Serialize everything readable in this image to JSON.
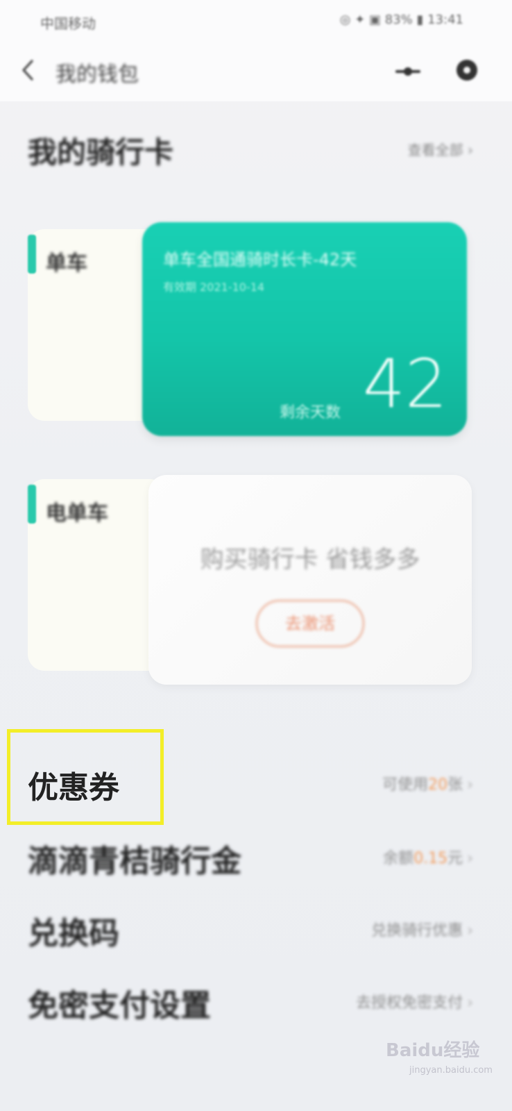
{
  "status_bar": {
    "carrier": "中国移动",
    "right_info": "◎ ✦ ▣ 83% ▮ 13:41"
  },
  "header": {
    "title": "我的钱包",
    "back_icon": "chevron-left-icon",
    "minimize_icon": "minimize-icon",
    "more_icon": "more-circle-icon"
  },
  "cards_section": {
    "title": "我的骑行卡",
    "view_all": "查看全部 ›",
    "categories": [
      {
        "label": "单车"
      },
      {
        "label": "电单车"
      }
    ],
    "active_card": {
      "title": "单车全国通骑时长卡-42天",
      "expire": "有效期 2021-10-14",
      "remain_label": "剩余天数",
      "days": "42"
    },
    "promo_card": {
      "text": "购买骑行卡 省钱多多",
      "button": "去激活"
    }
  },
  "menu": [
    {
      "label": "优惠券",
      "value_prefix": "可使用",
      "value_accent": "20",
      "value_suffix": "张"
    },
    {
      "label": "滴滴青桔骑行金",
      "value_prefix": "余额",
      "value_accent": "0.15",
      "value_suffix": "元"
    },
    {
      "label": "兑换码",
      "value_prefix": "兑换骑行优惠",
      "value_accent": "",
      "value_suffix": ""
    },
    {
      "label": "免密支付设置",
      "value_prefix": "去授权免密支付",
      "value_accent": "",
      "value_suffix": ""
    }
  ],
  "watermark": {
    "logo": "Baidu经验",
    "url": "jingyan.baidu.com"
  },
  "colors": {
    "teal": "#14c5a9",
    "highlight": "#f3ee28",
    "accent_orange": "#f29a5a"
  }
}
